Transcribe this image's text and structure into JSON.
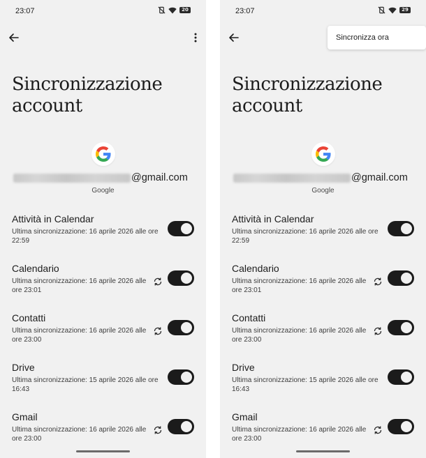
{
  "status_bar": {
    "time": "23:07"
  },
  "screens": [
    {
      "battery": "20"
    },
    {
      "battery": "29"
    }
  ],
  "page_title": "Sincronizzazione account",
  "account": {
    "email_domain": "@gmail.com",
    "type": "Google"
  },
  "sync_items": [
    {
      "name": "Attività in Calendar",
      "last_sync": "Ultima sincronizzazione: 16 aprile 2026 alle ore 22:59",
      "enabled": true
    },
    {
      "name": "Calendario",
      "last_sync": "Ultima sincronizzazione: 16 aprile 2026 alle ore 23:01",
      "enabled": true
    },
    {
      "name": "Contatti",
      "last_sync": "Ultima sincronizzazione: 16 aprile 2026 alle ore 23:00",
      "enabled": true
    },
    {
      "name": "Drive",
      "last_sync": "Ultima sincronizzazione: 15 aprile 2026 alle ore 16:43",
      "enabled": true
    },
    {
      "name": "Gmail",
      "last_sync": "Ultima sincronizzazione: 16 aprile 2026 alle ore 23:00",
      "enabled": true
    }
  ],
  "overflow_menu": {
    "items": [
      {
        "label": "Sincronizza ora"
      }
    ]
  },
  "icons": {
    "back": "arrow-left-icon",
    "more": "more-vert-icon",
    "sync": "sync-icon",
    "mute": "vibrate-off-icon",
    "wifi": "wifi-icon",
    "battery": "battery-icon",
    "google": "google-g-logo"
  },
  "colors": {
    "background": "#f1f1f1",
    "toggle_on": "#1b1b1b",
    "google_blue": "#4285F4",
    "google_red": "#EA4335",
    "google_yellow": "#FBBC05",
    "google_green": "#34A853"
  }
}
